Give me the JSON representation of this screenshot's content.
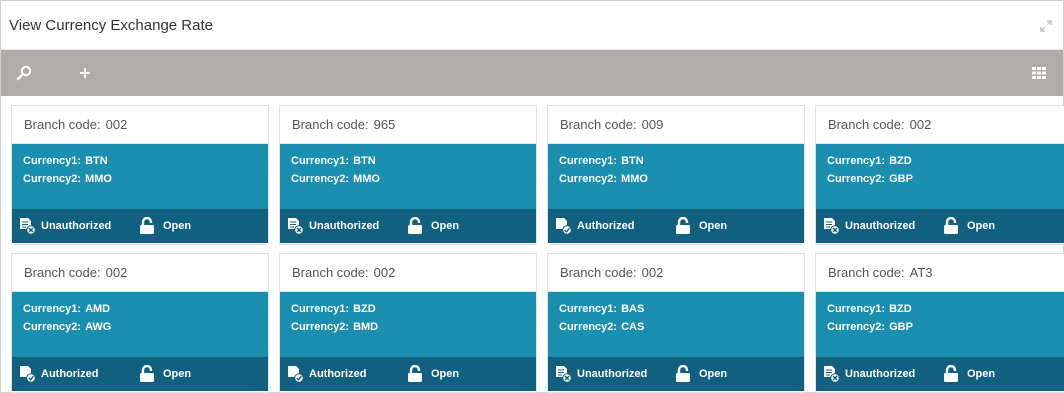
{
  "window": {
    "title": "View Currency Exchange Rate"
  },
  "toolbar": {
    "search_icon": "search-icon",
    "add_icon": "plus-icon",
    "view_icon": "grid-view-icon"
  },
  "labels": {
    "branch_code": "Branch code:",
    "currency1": "Currency1:",
    "currency2": "Currency2:"
  },
  "colors": {
    "toolbar": "#b0aca8",
    "card_body": "#1a8fb0",
    "card_footer": "#12607f"
  },
  "cards": [
    {
      "branch_code": "002",
      "currency1": "BTN",
      "currency2": "MMO",
      "auth_status": "Unauthorized",
      "record_status": "Open"
    },
    {
      "branch_code": "965",
      "currency1": "BTN",
      "currency2": "MMO",
      "auth_status": "Unauthorized",
      "record_status": "Open"
    },
    {
      "branch_code": "009",
      "currency1": "BTN",
      "currency2": "MMO",
      "auth_status": "Authorized",
      "record_status": "Open"
    },
    {
      "branch_code": "002",
      "currency1": "BZD",
      "currency2": "GBP",
      "auth_status": "Unauthorized",
      "record_status": "Open"
    },
    {
      "branch_code": "002",
      "currency1": "AMD",
      "currency2": "AWG",
      "auth_status": "Authorized",
      "record_status": "Open"
    },
    {
      "branch_code": "002",
      "currency1": "BZD",
      "currency2": "BMD",
      "auth_status": "Authorized",
      "record_status": "Open"
    },
    {
      "branch_code": "002",
      "currency1": "BAS",
      "currency2": "CAS",
      "auth_status": "Unauthorized",
      "record_status": "Open"
    },
    {
      "branch_code": "AT3",
      "currency1": "BZD",
      "currency2": "GBP",
      "auth_status": "Unauthorized",
      "record_status": "Open"
    }
  ]
}
